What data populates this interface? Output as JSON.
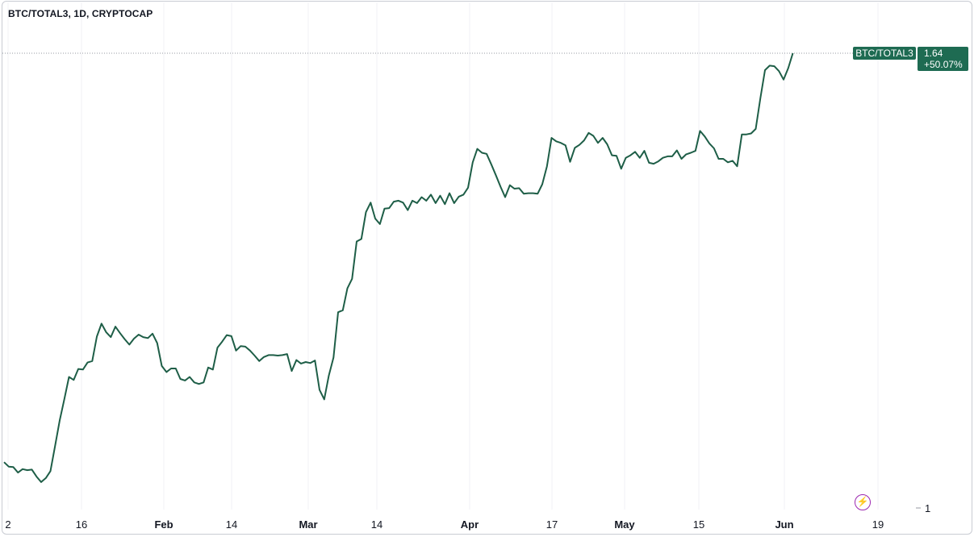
{
  "header": {
    "title": "BTC/TOTAL3, 1D, CRYPTOCAP"
  },
  "price_tag": {
    "symbol": "BTC/TOTAL3",
    "last_value": "1.64",
    "change": "+50.07%"
  },
  "colors": {
    "line": "#1e5e47",
    "tag_bg": "#1e6b52",
    "grid": "#f0f2f5",
    "axis_text": "#131722",
    "badge": "#9c27b0"
  },
  "icons": {
    "flash": "lightning-icon"
  },
  "chart_data": {
    "type": "line",
    "title": "BTC/TOTAL3, 1D, CRYPTOCAP",
    "x_tick_labels": [
      "2",
      "16",
      "Feb",
      "14",
      "Mar",
      "14",
      "Apr",
      "17",
      "May",
      "15",
      "Jun",
      "19"
    ],
    "y_tick_labels": [
      "1"
    ],
    "last_value": 1.64,
    "change_percent": "+50.07%",
    "grid": true,
    "series": [
      {
        "name": "BTC/TOTAL3",
        "y": [
          1.092,
          1.083,
          1.082,
          1.071,
          1.078,
          1.076,
          1.077,
          1.063,
          1.052,
          1.06,
          1.074,
          1.125,
          1.176,
          1.219,
          1.263,
          1.257,
          1.279,
          1.278,
          1.292,
          1.295,
          1.344,
          1.37,
          1.353,
          1.343,
          1.364,
          1.351,
          1.339,
          1.328,
          1.34,
          1.348,
          1.343,
          1.341,
          1.35,
          1.331,
          1.285,
          1.273,
          1.28,
          1.28,
          1.259,
          1.256,
          1.263,
          1.252,
          1.249,
          1.252,
          1.282,
          1.278,
          1.322,
          1.334,
          1.347,
          1.345,
          1.316,
          1.325,
          1.324,
          1.316,
          1.306,
          1.295,
          1.303,
          1.307,
          1.307,
          1.306,
          1.307,
          1.309,
          1.275,
          1.297,
          1.29,
          1.293,
          1.291,
          1.296,
          1.237,
          1.218,
          1.266,
          1.302,
          1.393,
          1.397,
          1.441,
          1.46,
          1.535,
          1.54,
          1.594,
          1.613,
          1.581,
          1.57,
          1.601,
          1.602,
          1.615,
          1.617,
          1.613,
          1.598,
          1.617,
          1.612,
          1.624,
          1.617,
          1.629,
          1.612,
          1.627,
          1.61,
          1.632,
          1.612,
          1.625,
          1.629,
          1.643,
          1.694,
          1.721,
          1.713,
          1.711,
          1.69,
          1.668,
          1.645,
          1.624,
          1.648,
          1.641,
          1.642,
          1.631,
          1.632,
          1.632,
          1.631,
          1.65,
          1.686,
          1.743,
          1.736,
          1.733,
          1.728,
          1.695,
          1.723,
          1.729,
          1.738,
          1.753,
          1.747,
          1.733,
          1.743,
          1.73,
          1.708,
          1.707,
          1.681,
          1.703,
          1.708,
          1.715,
          1.703,
          1.717,
          1.693,
          1.691,
          1.696,
          1.703,
          1.706,
          1.706,
          1.718,
          1.701,
          1.71,
          1.713,
          1.717,
          1.757,
          1.746,
          1.732,
          1.722,
          1.701,
          1.701,
          1.694,
          1.697,
          1.686,
          1.75,
          1.75,
          1.752,
          1.761,
          1.823,
          1.879,
          1.888,
          1.887,
          1.877,
          1.86,
          1.883,
          1.913
        ]
      }
    ]
  }
}
